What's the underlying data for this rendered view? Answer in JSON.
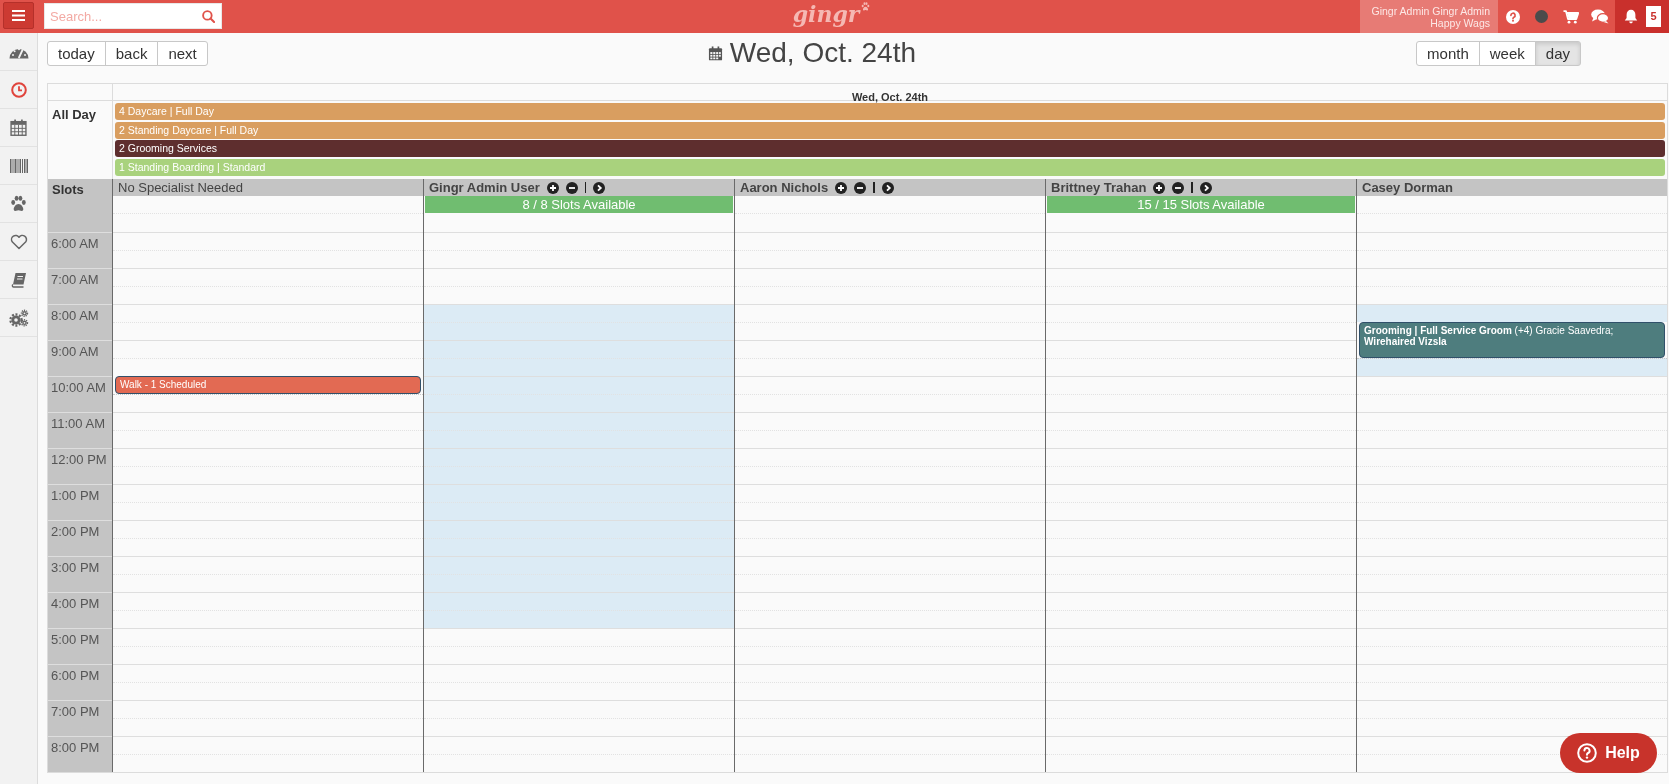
{
  "topbar": {
    "search": {
      "placeholder": "Search..."
    },
    "logo": "gingr",
    "user": {
      "name": "Gingr Admin Gingr Admin",
      "business": "Happy Wags"
    },
    "notifications": {
      "count": "5"
    }
  },
  "sidebar": {
    "items": [
      {
        "selected": false
      },
      {
        "selected": true
      },
      {
        "selected": false
      },
      {
        "selected": false
      },
      {
        "selected": false
      },
      {
        "selected": false
      },
      {
        "selected": false
      },
      {
        "selected": false
      }
    ]
  },
  "toolbar": {
    "nav_buttons": [
      "today",
      "back",
      "next"
    ],
    "title": "Wed, Oct. 24th",
    "views": [
      {
        "label": "month",
        "selected": false
      },
      {
        "label": "week",
        "selected": false
      },
      {
        "label": "day",
        "selected": true
      }
    ]
  },
  "calendar": {
    "day_header": "Wed, Oct. 24th",
    "all_day": {
      "label": "All Day",
      "events": [
        {
          "text": "4 Daycare | Full Day",
          "color": "#d99e60"
        },
        {
          "text": "2 Standing Daycare | Full Day",
          "color": "#d99e60"
        },
        {
          "text": "2 Grooming Services",
          "color": "#5e2e2e"
        },
        {
          "text": "1 Standing Boarding | Standard",
          "color": "#a9d27d"
        }
      ]
    },
    "slots_label": "Slots",
    "times": [
      "6:00 AM",
      "7:00 AM",
      "8:00 AM",
      "9:00 AM",
      "10:00 AM",
      "11:00 AM",
      "12:00 PM",
      "1:00 PM",
      "2:00 PM",
      "3:00 PM",
      "4:00 PM",
      "5:00 PM",
      "6:00 PM",
      "7:00 PM",
      "8:00 PM"
    ],
    "resources": [
      {
        "name": "No Specialist Needed",
        "kind": "unassigned",
        "controls": false,
        "hours": [
          {
            "available": false
          },
          {
            "available": false
          },
          {
            "available": false
          },
          {
            "available": false
          },
          {
            "available": false,
            "events": [
              {
                "text": "Walk - 1 Scheduled",
                "color": "#e26a53",
                "half_past": false,
                "full_hour": false
              }
            ]
          },
          {
            "available": false
          },
          {
            "available": false
          },
          {
            "available": false
          },
          {
            "available": false
          },
          {
            "available": false
          },
          {
            "available": false
          },
          {
            "available": false
          },
          {
            "available": false
          },
          {
            "available": false
          },
          {
            "available": false
          }
        ]
      },
      {
        "name": "Gingr Admin User",
        "kind": "staff",
        "controls": true,
        "slots": "8 / 8 Slots Available",
        "hours": [
          {
            "available": false
          },
          {
            "available": false
          },
          {
            "available": true
          },
          {
            "available": true
          },
          {
            "available": true
          },
          {
            "available": true
          },
          {
            "available": true
          },
          {
            "available": true
          },
          {
            "available": true
          },
          {
            "available": true
          },
          {
            "available": true
          },
          {
            "available": false
          },
          {
            "available": false
          },
          {
            "available": false
          },
          {
            "available": false
          }
        ]
      },
      {
        "name": "Aaron Nichols",
        "kind": "staff",
        "controls": true,
        "hours": [
          {
            "available": false
          },
          {
            "available": false
          },
          {
            "available": false
          },
          {
            "available": false
          },
          {
            "available": false
          },
          {
            "available": false
          },
          {
            "available": false
          },
          {
            "available": false
          },
          {
            "available": false
          },
          {
            "available": false
          },
          {
            "available": false
          },
          {
            "available": false
          },
          {
            "available": false
          },
          {
            "available": false
          },
          {
            "available": false
          }
        ]
      },
      {
        "name": "Brittney Trahan",
        "kind": "staff",
        "controls": true,
        "slots": "15 / 15 Slots Available",
        "hours": [
          {
            "available": false
          },
          {
            "available": false
          },
          {
            "available": false
          },
          {
            "available": false
          },
          {
            "available": false
          },
          {
            "available": false
          },
          {
            "available": false
          },
          {
            "available": false
          },
          {
            "available": false
          },
          {
            "available": false
          },
          {
            "available": false
          },
          {
            "available": false
          },
          {
            "available": false
          },
          {
            "available": false
          },
          {
            "available": false
          }
        ]
      },
      {
        "name": "Casey Dorman",
        "kind": "staff",
        "controls": false,
        "hours": [
          {
            "available": false
          },
          {
            "available": false
          },
          {
            "available": true,
            "events": [
              {
                "text": "**Grooming | Full Service Groom** (+4) Gracie Saavedra; **Wirehaired Vizsla**",
                "color": "#4e7d7e",
                "half_past": true,
                "full_hour": true
              }
            ]
          },
          {
            "available": true
          },
          {
            "available": false
          },
          {
            "available": false
          },
          {
            "available": false
          },
          {
            "available": false
          },
          {
            "available": false
          },
          {
            "available": false
          },
          {
            "available": false
          },
          {
            "available": false
          },
          {
            "available": false
          },
          {
            "available": false
          },
          {
            "available": false
          }
        ]
      }
    ]
  },
  "help": {
    "label": "Help"
  }
}
